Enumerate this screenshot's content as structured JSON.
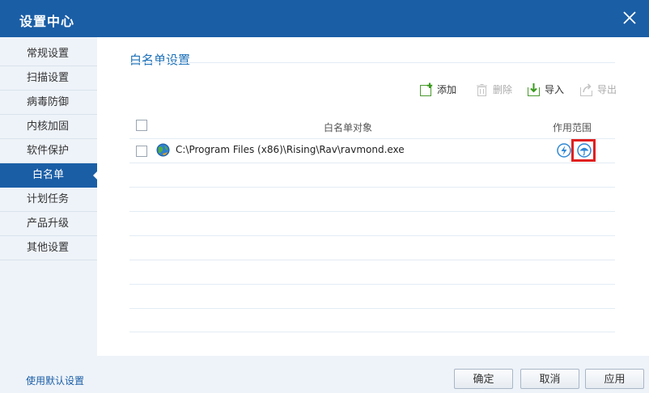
{
  "window": {
    "title": "设置中心"
  },
  "sidebar": {
    "items": [
      {
        "label": "常规设置"
      },
      {
        "label": "扫描设置"
      },
      {
        "label": "病毒防御"
      },
      {
        "label": "内核加固"
      },
      {
        "label": "软件保护"
      },
      {
        "label": "白名单",
        "active": true
      },
      {
        "label": "计划任务"
      },
      {
        "label": "产品升级"
      },
      {
        "label": "其他设置"
      }
    ]
  },
  "main": {
    "section_title": "白名单设置",
    "toolbar": {
      "add": "添加",
      "delete": "删除",
      "import": "导入",
      "export": "导出"
    },
    "table": {
      "headers": {
        "object": "白名单对象",
        "scope": "作用范围"
      },
      "rows": [
        {
          "path": "C:\\Program Files (x86)\\Rising\\Rav\\ravmond.exe",
          "checked": false
        }
      ]
    }
  },
  "footer": {
    "default_link": "使用默认设置",
    "ok": "确定",
    "cancel": "取消",
    "apply": "应用"
  },
  "colors": {
    "brand": "#1a5ea6",
    "highlight": "#e02020",
    "sidebar_bg": "#eef3f9"
  }
}
